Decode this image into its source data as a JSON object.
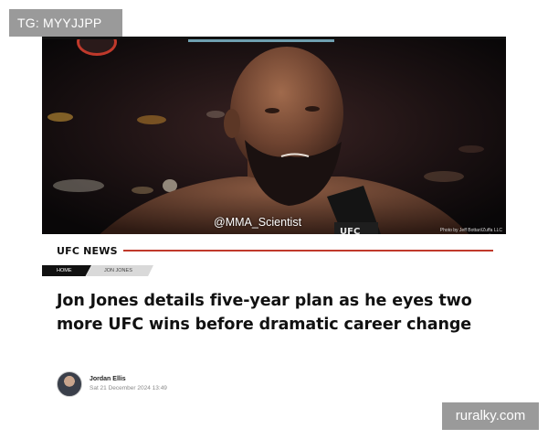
{
  "watermarks": {
    "top_left": "TG: MYYJJPP",
    "bottom_right": "ruralky.com"
  },
  "hero": {
    "weibo_handle": "@MMA_Scientist",
    "photo_credit": "Photo by Jeff Bottari/Zuffa LLC"
  },
  "section": {
    "title": "UFC NEWS",
    "accent_color": "#c0392b"
  },
  "breadcrumb": {
    "home": "HOME",
    "current": "JON JONES"
  },
  "article": {
    "headline": "Jon Jones details five-year plan as he eyes two more UFC wins before dramatic career change",
    "author": "Jordan Ellis",
    "date": "Sat 21 December 2024 13:49"
  }
}
